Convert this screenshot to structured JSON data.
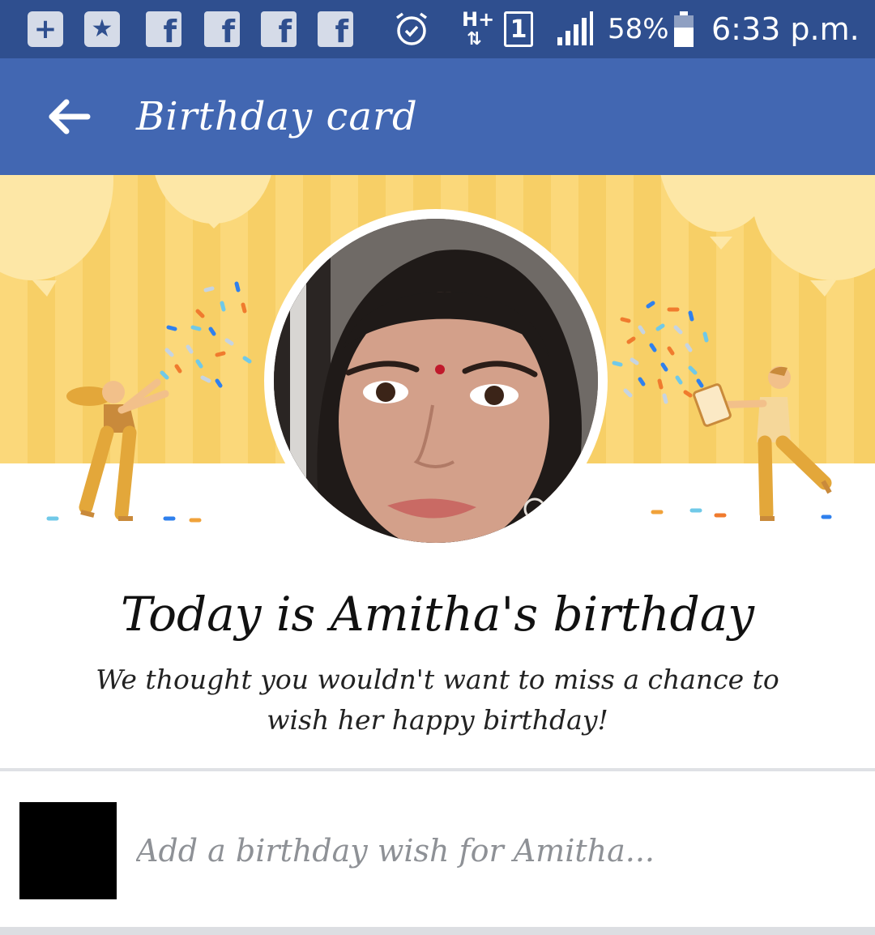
{
  "status_bar": {
    "icons": [
      "plus-icon",
      "star-badge-icon",
      "facebook-icon",
      "facebook-icon",
      "facebook-icon",
      "facebook-icon",
      "alarm-icon",
      "network-hplus-icon",
      "sim-1-icon",
      "signal-icon",
      "battery-icon"
    ],
    "network_label": "H+",
    "sim_label": "1",
    "battery_percent": "58%",
    "time": "6:33 p.m."
  },
  "appbar": {
    "title": "Birthday card",
    "back_icon": "back-arrow-icon"
  },
  "card": {
    "headline": "Today is Amitha's birthday",
    "subline": "We thought you wouldn't want to miss a chance to wish her happy birthday!"
  },
  "composer": {
    "placeholder": "Add a birthday wish for Amitha..."
  },
  "colors": {
    "status_bar": "#2f4f8f",
    "app_bar": "#4267b2",
    "banner_yellow": "#fbd87a",
    "figure_ochre": "#e3a73a"
  }
}
